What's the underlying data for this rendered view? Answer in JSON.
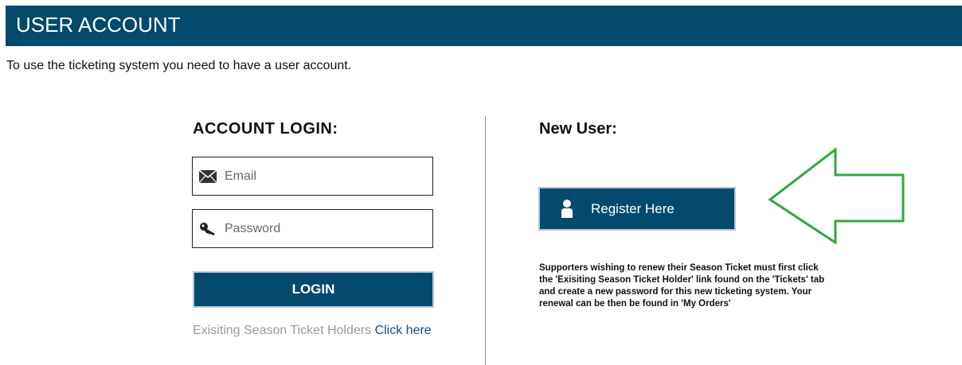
{
  "header": {
    "title": "USER ACCOUNT"
  },
  "intro_text": "To use the ticketing system you need to have a user account.",
  "login": {
    "heading": "ACCOUNT LOGIN:",
    "email_placeholder": "Email",
    "password_placeholder": "Password",
    "button_label": "LOGIN",
    "holders_text": "Exisiting Season Ticket Holders",
    "holders_link": "Click here"
  },
  "new_user": {
    "heading": "New User:",
    "register_label": "Register Here",
    "note": "Supporters wishing to renew their Season Ticket must first click the 'Exisiting Season Ticket Holder' link found on the 'Tickets' tab and create a new password for this new ticketing system. Your renewal can be then be found in 'My Orders'"
  },
  "colors": {
    "brand": "#044a6e",
    "arrow": "#2eaa3f",
    "link": "#1e4d7a"
  },
  "icons": [
    "envelope-icon",
    "key-icon",
    "user-icon",
    "arrow-left-icon"
  ]
}
